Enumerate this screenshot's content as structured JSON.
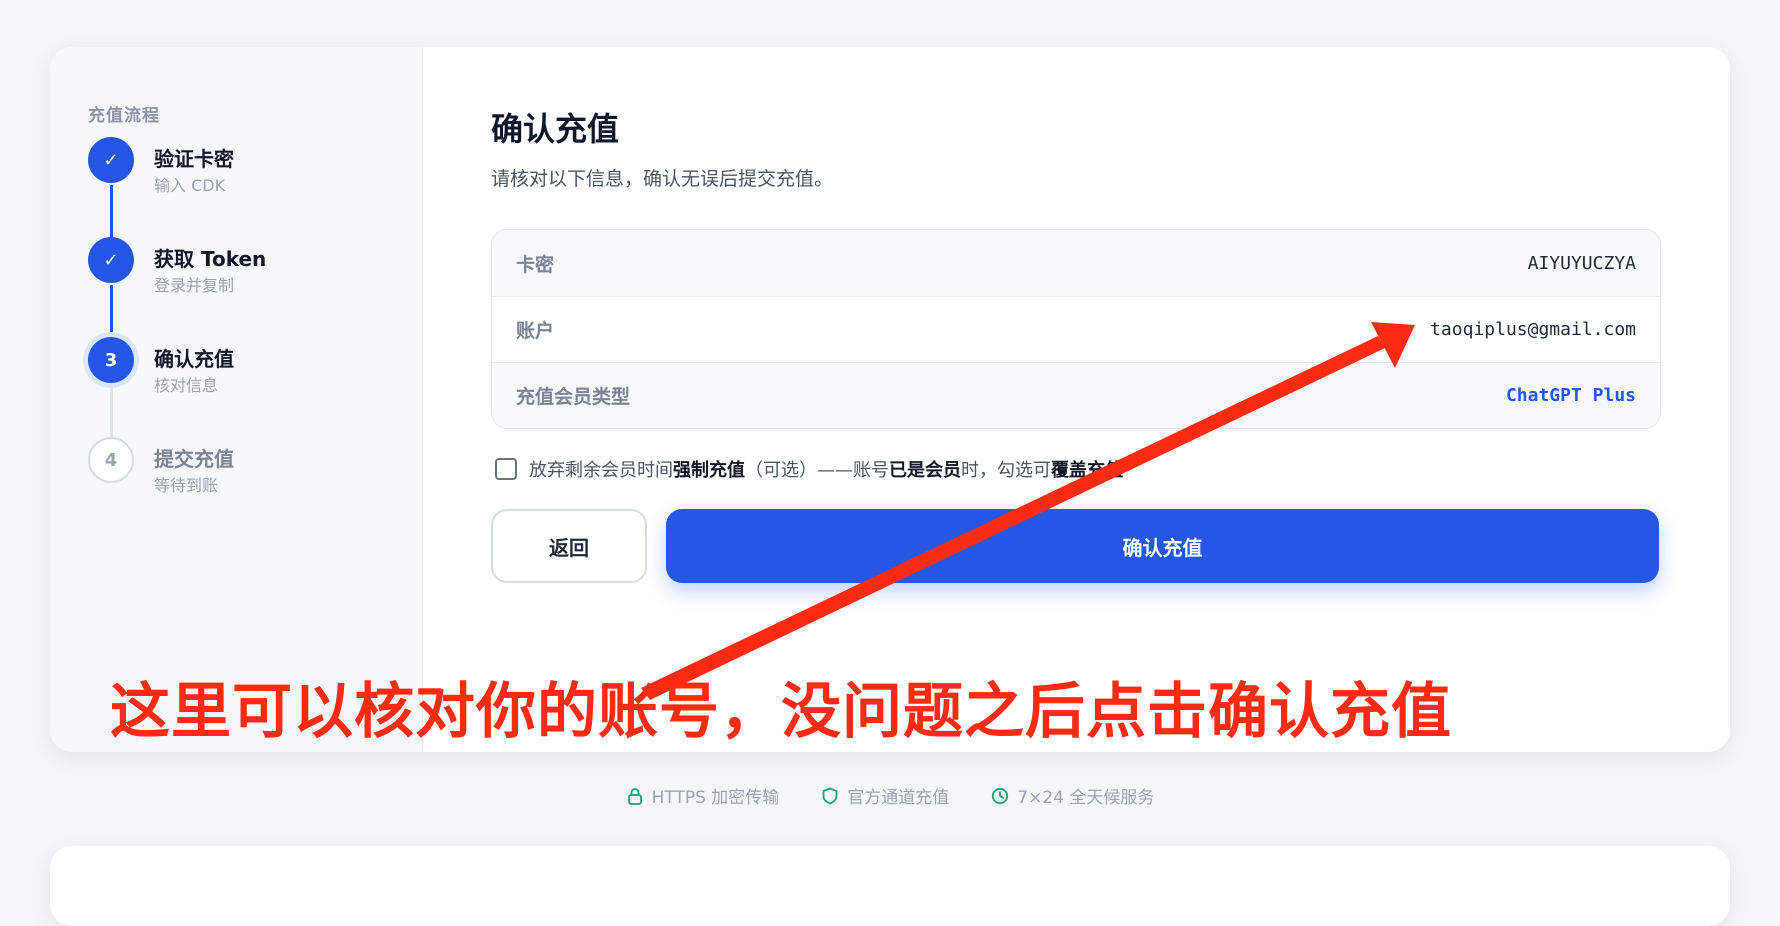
{
  "sidebar": {
    "title": "充值流程",
    "steps": [
      {
        "marker": "✓",
        "label": "验证卡密",
        "sub": "输入 CDK",
        "state": "done"
      },
      {
        "marker": "✓",
        "label": "获取 Token",
        "sub": "登录并复制",
        "state": "done"
      },
      {
        "marker": "3",
        "label": "确认充值",
        "sub": "核对信息",
        "state": "active"
      },
      {
        "marker": "4",
        "label": "提交充值",
        "sub": "等待到账",
        "state": "todo"
      }
    ]
  },
  "main": {
    "title": "确认充值",
    "subtitle": "请核对以下信息，确认无误后提交充值。",
    "info_rows": [
      {
        "label": "卡密",
        "value": "AIYUYUCZYA"
      },
      {
        "label": "账户",
        "value": "taoqiplus@gmail.com"
      },
      {
        "label": "充值会员类型",
        "value": "ChatGPT Plus"
      }
    ],
    "option": {
      "checked": false,
      "text_1": "放弃剩余会员时间",
      "text_2": "强制充值",
      "text_3": "（可选）——账号",
      "text_4": "已是会员",
      "text_5": "时，勾选可",
      "text_6": "覆盖充值"
    },
    "back_label": "返回",
    "confirm_label": "确认充值"
  },
  "annotation": {
    "text": "这里可以核对你的账号，没问题之后点击确认充值",
    "color": "#ff2a12"
  },
  "trust": [
    {
      "icon": "lock-icon",
      "label": "HTTPS 加密传输"
    },
    {
      "icon": "shield-icon",
      "label": "官方通道充值"
    },
    {
      "icon": "clock-icon",
      "label": "7×24 全天候服务"
    }
  ],
  "colors": {
    "accent": "#2457e6",
    "trust_icon": "#22a06b"
  }
}
